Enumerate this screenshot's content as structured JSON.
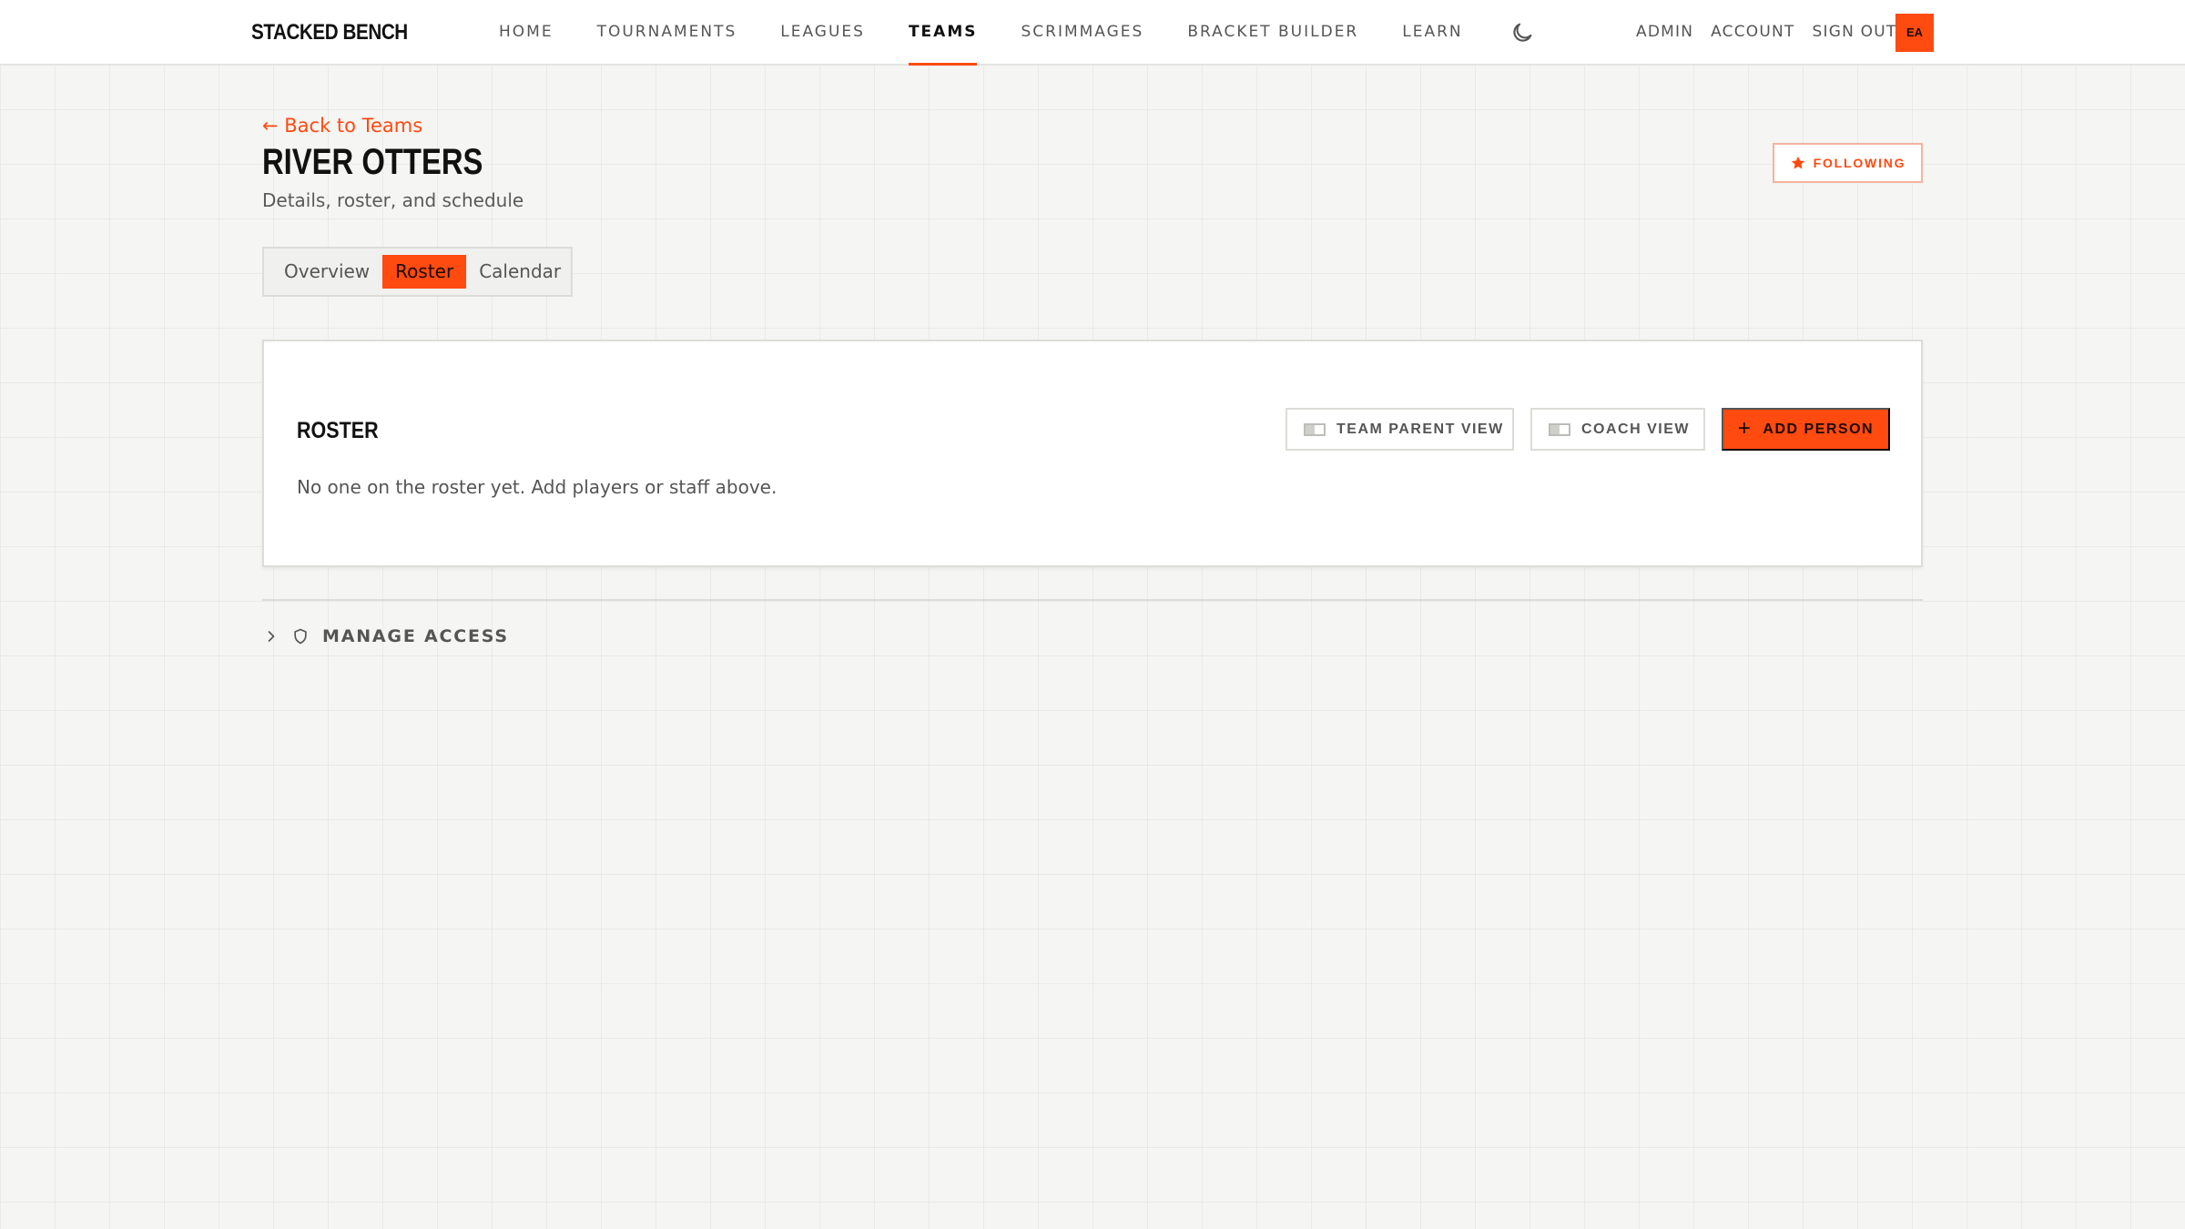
{
  "brand": "STACKED BENCH",
  "nav": {
    "items": [
      {
        "label": "HOME"
      },
      {
        "label": "TOURNAMENTS"
      },
      {
        "label": "LEAGUES"
      },
      {
        "label": "TEAMS",
        "active": true
      },
      {
        "label": "SCRIMMAGES"
      },
      {
        "label": "BRACKET BUILDER"
      },
      {
        "label": "LEARN"
      }
    ],
    "theme_icon": "moon-icon",
    "right_items": [
      {
        "label": "ADMIN"
      },
      {
        "label": "ACCOUNT"
      },
      {
        "label": "SIGN OUT"
      }
    ],
    "avatar_initials": "EA"
  },
  "header": {
    "back_label": "← Back to Teams",
    "title": "RIVER OTTERS",
    "subtitle": "Details, roster, and schedule",
    "follow_label": "FOLLOWING",
    "follow_icon": "star-icon"
  },
  "tabs": [
    {
      "label": "Overview"
    },
    {
      "label": "Roster",
      "active": true
    },
    {
      "label": "Calendar"
    }
  ],
  "roster": {
    "title": "ROSTER",
    "empty_message": "No one on the roster yet. Add players or staff above.",
    "team_parent_view_label": "TEAM PARENT VIEW",
    "coach_view_label": "COACH VIEW",
    "add_person_label": "ADD PERSON"
  },
  "manage_access": {
    "label": "MANAGE ACCESS",
    "chevron_icon": "chevron-right-icon",
    "shield_icon": "shield-icon"
  },
  "colors": {
    "accent": "#ff4a10",
    "background": "#f5f5f3",
    "text": "#1a1a1a"
  }
}
